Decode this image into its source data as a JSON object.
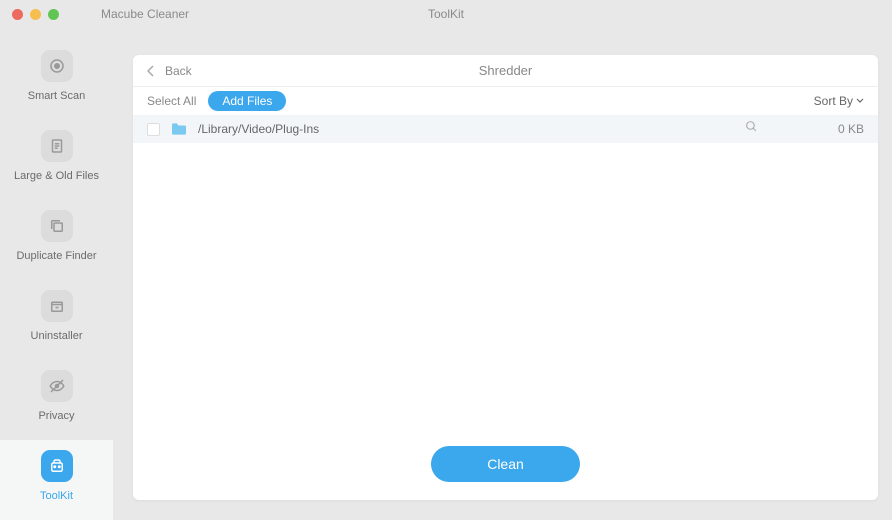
{
  "app": {
    "name": "Macube Cleaner",
    "header_title": "ToolKit"
  },
  "sidebar": {
    "items": [
      {
        "label": "Smart Scan"
      },
      {
        "label": "Large & Old Files"
      },
      {
        "label": "Duplicate Finder"
      },
      {
        "label": "Uninstaller"
      },
      {
        "label": "Privacy"
      },
      {
        "label": "ToolKit"
      }
    ]
  },
  "panel": {
    "back_label": "Back",
    "title": "Shredder"
  },
  "toolbar": {
    "select_all": "Select All",
    "add_files": "Add Files",
    "sort_by": "Sort By"
  },
  "files": [
    {
      "path": "/Library/Video/Plug-Ins",
      "size": "0 KB"
    }
  ],
  "footer": {
    "clean": "Clean"
  }
}
